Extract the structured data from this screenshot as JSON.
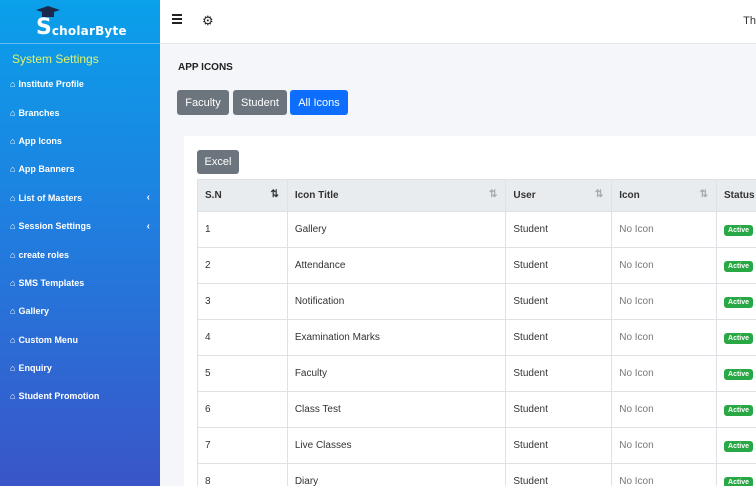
{
  "brand": {
    "logo_letter": "S",
    "logo_rest": "cholarByte"
  },
  "sidebar": {
    "section_title": "System Settings",
    "items": [
      {
        "label": "Institute Profile",
        "has_submenu": false
      },
      {
        "label": "Branches",
        "has_submenu": false
      },
      {
        "label": "App Icons",
        "has_submenu": false
      },
      {
        "label": "App Banners",
        "has_submenu": false
      },
      {
        "label": "List of Masters",
        "has_submenu": true
      },
      {
        "label": "Session Settings",
        "has_submenu": true
      },
      {
        "label": "create roles",
        "has_submenu": false
      },
      {
        "label": "SMS Templates",
        "has_submenu": false
      },
      {
        "label": "Gallery",
        "has_submenu": false
      },
      {
        "label": "Custom Menu",
        "has_submenu": false
      },
      {
        "label": "Enquiry",
        "has_submenu": false
      },
      {
        "label": "Student Promotion",
        "has_submenu": false
      }
    ]
  },
  "topbar": {
    "user_text": "Th"
  },
  "page": {
    "title": "APP ICONS",
    "tabs": {
      "faculty": "Faculty",
      "student": "Student",
      "all": "All Icons"
    },
    "excel_label": "Excel"
  },
  "table": {
    "headers": {
      "sn": "S.N",
      "title": "Icon Title",
      "user": "User",
      "icon": "Icon",
      "status": "Status"
    },
    "rows": [
      {
        "sn": "1",
        "title": "Gallery",
        "user": "Student",
        "icon": "No Icon",
        "status": "Active"
      },
      {
        "sn": "2",
        "title": "Attendance",
        "user": "Student",
        "icon": "No Icon",
        "status": "Active"
      },
      {
        "sn": "3",
        "title": "Notification",
        "user": "Student",
        "icon": "No Icon",
        "status": "Active"
      },
      {
        "sn": "4",
        "title": "Examination Marks",
        "user": "Student",
        "icon": "No Icon",
        "status": "Active"
      },
      {
        "sn": "5",
        "title": "Faculty",
        "user": "Student",
        "icon": "No Icon",
        "status": "Active"
      },
      {
        "sn": "6",
        "title": "Class Test",
        "user": "Student",
        "icon": "No Icon",
        "status": "Active"
      },
      {
        "sn": "7",
        "title": "Live Classes",
        "user": "Student",
        "icon": "No Icon",
        "status": "Active"
      },
      {
        "sn": "8",
        "title": "Diary",
        "user": "Student",
        "icon": "No Icon",
        "status": "Active"
      }
    ]
  },
  "colors": {
    "accent": "#0d6efd",
    "secondary": "#6c757d",
    "active_badge": "#28a745",
    "sidebar_section": "#e3f36a"
  }
}
